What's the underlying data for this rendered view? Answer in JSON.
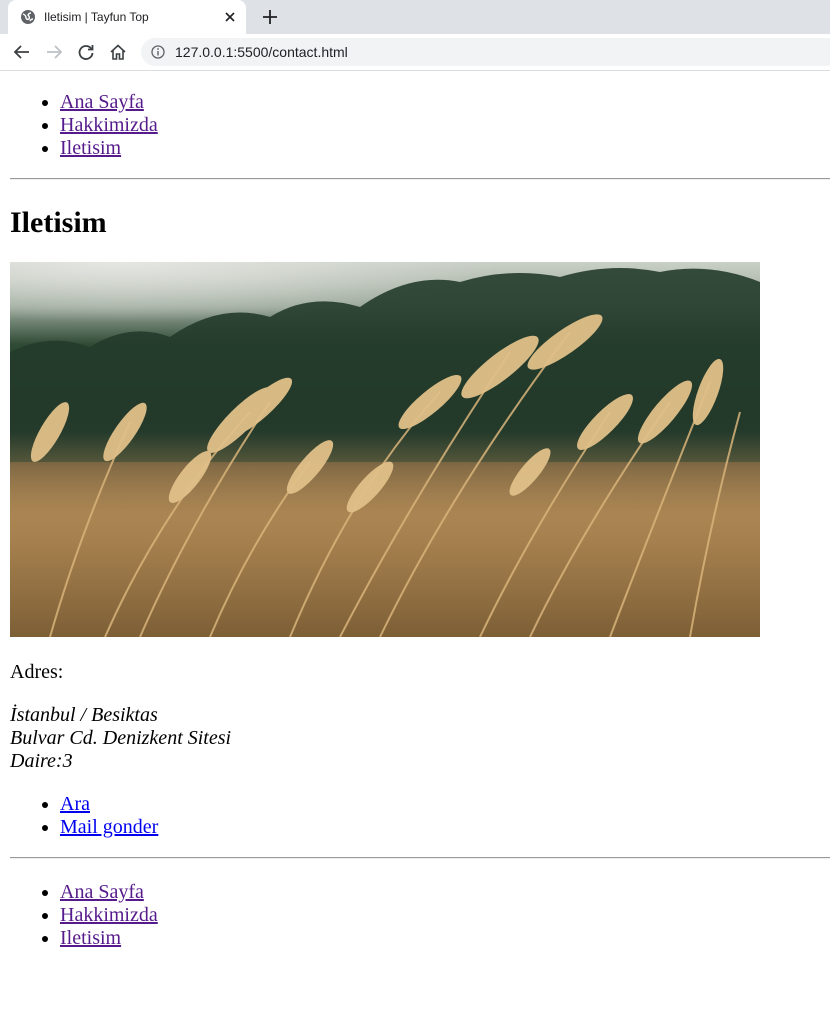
{
  "browser": {
    "tab_title": "Iletisim | Tayfun Top",
    "url": "127.0.0.1:5500/contact.html"
  },
  "nav_top": [
    {
      "label": "Ana Sayfa"
    },
    {
      "label": "Hakkimizda"
    },
    {
      "label": "Iletisim"
    }
  ],
  "heading": "Iletisim",
  "image": {
    "subject": "wheat field"
  },
  "address_label": "Adres:",
  "address_lines": [
    "İstanbul / Besiktas",
    "Bulvar Cd. Denizkent Sitesi",
    "Daire:3"
  ],
  "actions": [
    {
      "label": "Ara"
    },
    {
      "label": "Mail gonder"
    }
  ],
  "nav_bottom": [
    {
      "label": "Ana Sayfa"
    },
    {
      "label": "Hakkimizda"
    },
    {
      "label": "Iletisim"
    }
  ],
  "colors": {
    "link_visited": "#551a8b",
    "link_unvisited": "#0000ee",
    "tabstrip": "#dee1e6"
  }
}
